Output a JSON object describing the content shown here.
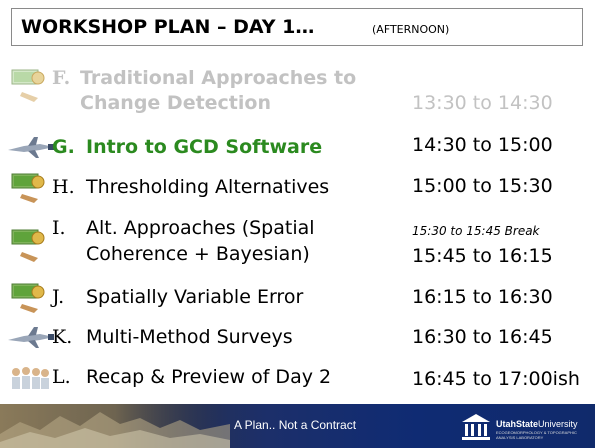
{
  "title": {
    "main": "WORKSHOP PLAN – DAY 1…",
    "sub": "(AFTERNOON)"
  },
  "rows": [
    {
      "letter": "F.",
      "label_line1": "Traditional Approaches to",
      "label_line2": "Change Detection",
      "time": "13:30 to 14:30",
      "state": "faded",
      "icon": "book-globe-icon"
    },
    {
      "letter": "G.",
      "label_line1": "Intro to GCD Software",
      "time": "14:30 to 15:00",
      "state": "active",
      "icon": "plane-icon"
    },
    {
      "letter": "H.",
      "label_line1": "Thresholding Alternatives",
      "time": "15:00 to 15:30",
      "state": "normal",
      "icon": "book-globe-icon"
    },
    {
      "letter": "I.",
      "label_line1": "Alt. Approaches (Spatial",
      "label_line2": "Coherence + Bayesian)",
      "time": "15:45 to 16:15",
      "state": "normal",
      "icon": "book-globe-icon"
    },
    {
      "letter": "J.",
      "label_line1": "Spatially Variable Error",
      "time": "16:15 to 16:30",
      "state": "normal",
      "icon": "book-globe-icon"
    },
    {
      "letter": "K.",
      "label_line1": "Multi-Method Surveys",
      "time": "16:30 to 16:45",
      "state": "normal",
      "icon": "plane-icon"
    },
    {
      "letter": "L.",
      "label_line1": "Recap & Preview of Day 2",
      "time": "16:45 to 17:00ish",
      "state": "normal",
      "icon": "people-icon"
    }
  ],
  "break_note": "15:30 to 15:45 Break",
  "footer": {
    "text": "A Plan.. Not a Contract",
    "logo_name_bold": "UtahState",
    "logo_name_rest": "University",
    "logo_sub_line1": "ECOGEOMORPHOLOGY & TOPOGRAPHIC",
    "logo_sub_line2": "ANALYSIS LABORATORY"
  },
  "colors": {
    "active": "#2b8a1f",
    "faded": "#c2c2c2",
    "footer_blue": "#0f2b73"
  }
}
